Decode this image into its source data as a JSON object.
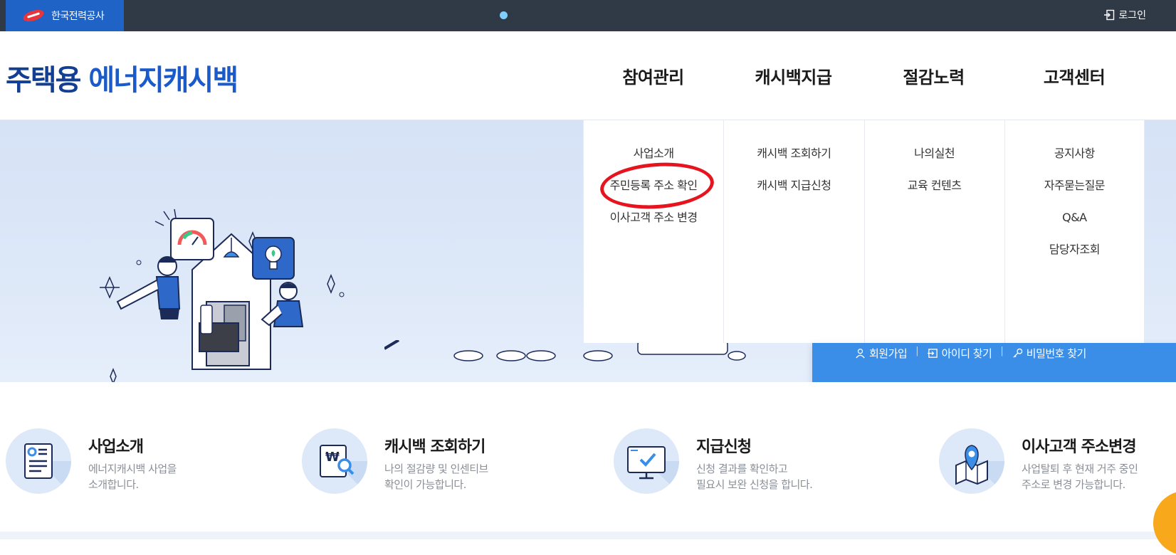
{
  "topbar": {
    "company": "한국전력공사",
    "login_label": "로그인"
  },
  "header": {
    "title_part1": "주택용",
    "title_part2": "에너지캐시백",
    "nav": [
      "참여관리",
      "캐시백지급",
      "절감노력",
      "고객센터"
    ]
  },
  "dropdown": {
    "columns": [
      [
        "사업소개",
        "주민등록 주소 확인",
        "이사고객 주소 변경"
      ],
      [
        "캐시백 조회하기",
        "캐시백 지급신청"
      ],
      [
        "나의실천",
        "교육 컨텐츠"
      ],
      [
        "공지사항",
        "자주묻는질문",
        "Q&A",
        "담당자조회"
      ]
    ]
  },
  "login_panel": {
    "signup": "회원가입",
    "find_id": "아이디 찾기",
    "find_pw": "비밀번호 찾기"
  },
  "services": [
    {
      "title": "사업소개",
      "desc1": "에너지캐시백 사업을",
      "desc2": "소개합니다."
    },
    {
      "title": "캐시백 조회하기",
      "desc1": "나의 절감량 및 인센티브",
      "desc2": "확인이 가능합니다."
    },
    {
      "title": "지급신청",
      "desc1": "신청 결과를 확인하고",
      "desc2": "필요시 보완 신청을 합니다."
    },
    {
      "title": "이사고객 주소변경",
      "desc1": "사업탈퇴 후 현재 거주 중인",
      "desc2": "주소로 변경 가능합니다."
    }
  ],
  "colors": {
    "topbar": "#2f3a46",
    "brand_blue": "#1f63c6",
    "panel_blue": "#3a8ee8",
    "annotation_red": "#e5141e"
  }
}
